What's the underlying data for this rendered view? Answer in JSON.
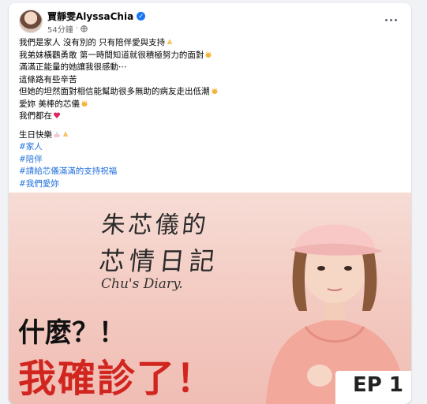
{
  "post": {
    "author": "賈靜雯AlyssaChia",
    "timestamp": "54分鐘",
    "separator": "·",
    "lines": [
      "我們是家人 沒有別的 只有陪伴愛與支持",
      "我弟妹橫鸛勇敢 第一時間知道就很積極努力的面對",
      "滿滿正能量的她讓我很感動⋯",
      "這條路有些辛苦",
      "但她的坦然面對相信能幫助很多無助的病友走出低潮",
      "愛妳 美棒的芯儀",
      "我們都在"
    ],
    "birthday_line": "生日快樂",
    "hashtags": [
      "#家人",
      "#陪伴",
      "#請給芯儀滿滿的支持祝福",
      "#我們愛妳"
    ]
  },
  "media": {
    "title_line1": "朱芯儀的",
    "title_line2": "芯情日記",
    "script_title": "Chu's Diary.",
    "caption1": "什麼？！",
    "caption2": "我確診了！",
    "episode": "EP 1"
  },
  "colors": {
    "hashtag": "#216fdb",
    "verified": "#1877f2",
    "caption_red": "#d1261f"
  },
  "icons": {
    "verified": "verified-badge-icon",
    "privacy": "globe-icon",
    "more": "more-options-icon",
    "pray": "folded-hands-emoji",
    "clap": "clapping-hands-emoji",
    "heart": "red-heart-emoji",
    "cake": "birthday-cake-emoji"
  }
}
